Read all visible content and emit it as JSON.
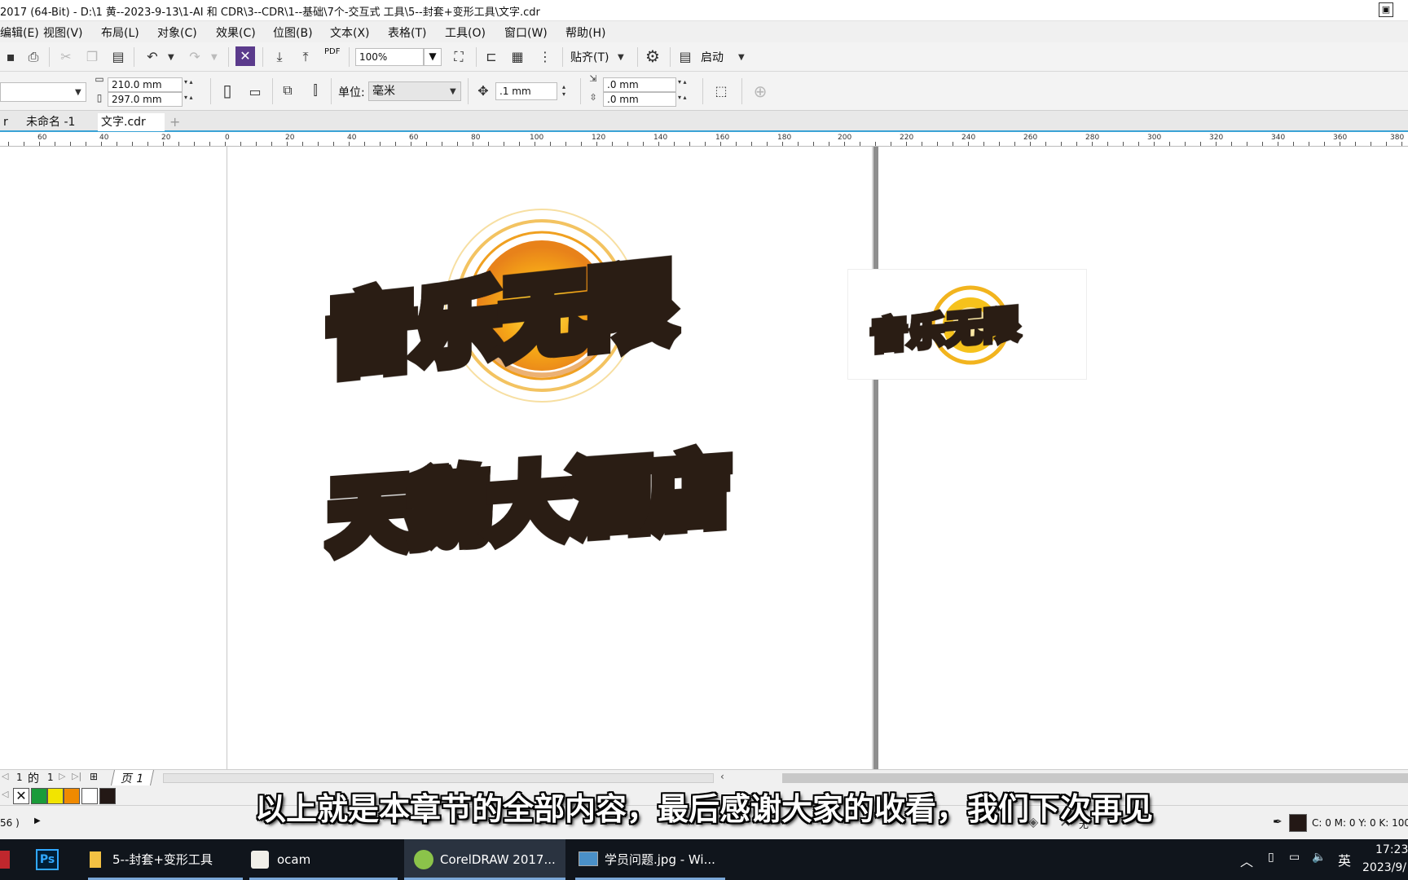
{
  "title_bar": {
    "title": "2017 (64-Bit) - D:\\1 黄--2023-9-13\\1-AI 和 CDR\\3--CDR\\1--基础\\7个-交互式 工具\\5--封套+变形工具\\文字.cdr"
  },
  "menu": {
    "items": [
      "编辑(E)",
      "视图(V)",
      "布局(L)",
      "对象(C)",
      "效果(C)",
      "位图(B)",
      "文本(X)",
      "表格(T)",
      "工具(O)",
      "窗口(W)",
      "帮助(H)"
    ]
  },
  "toolbar": {
    "zoom_value": "100%",
    "pdf_label": "PDF",
    "snap_label": "贴齐(T)",
    "launch_label": "启动"
  },
  "property_bar": {
    "width_value": "210.0 mm",
    "height_value": "297.0 mm",
    "unit_label": "单位:",
    "unit_value": "毫米",
    "nudge_value": ".1 mm",
    "dup_x_value": ".0 mm",
    "dup_y_value": ".0 mm"
  },
  "tabs": [
    {
      "label": "r"
    },
    {
      "label": "未命名 -1"
    },
    {
      "label": "文字.cdr"
    }
  ],
  "ruler": {
    "labels": [
      "60",
      "40",
      "20",
      "0",
      "20",
      "40",
      "60",
      "80",
      "100",
      "120",
      "140",
      "160",
      "180",
      "200",
      "220",
      "240",
      "260",
      "280",
      "300",
      "320",
      "340",
      "360",
      "380"
    ]
  },
  "artwork": {
    "logo1": "音乐无限",
    "logo2": "天鹅大酒店",
    "thumb_logo": "音乐无限"
  },
  "page_nav": {
    "current": "1",
    "of_label": "的",
    "total": "1",
    "page_tab": "页 1"
  },
  "palette": {
    "colors": [
      "#1a9b3a",
      "#f2e400",
      "#f08a00",
      "#ffffff",
      "#231815"
    ]
  },
  "status_bar": {
    "left_text": "56 )",
    "fill_label": "无",
    "color_readout": "C: 0 M: 0 Y: 0 K: 100"
  },
  "subtitle": "以上就是本章节的全部内容，最后感谢大家的收看，我们下次再见",
  "taskbar": {
    "items": [
      {
        "label": "5--封套+变形工具"
      },
      {
        "label": "ocam"
      },
      {
        "label": "CorelDRAW 2017..."
      },
      {
        "label": "学员问题.jpg - Wi..."
      }
    ],
    "ps_label": "Ps",
    "ime_label": "英",
    "time": "17:23",
    "date": "2023/9/"
  }
}
